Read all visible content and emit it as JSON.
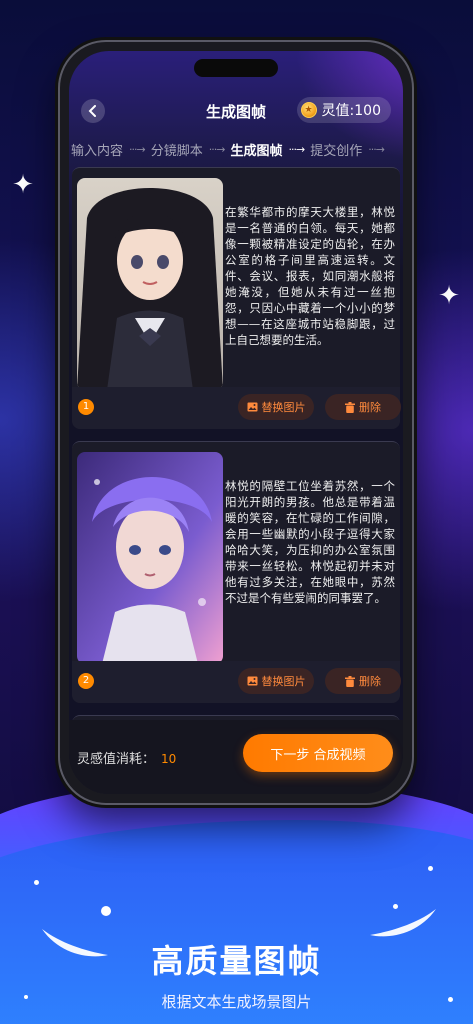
{
  "header": {
    "title": "生成图帧",
    "balance_label": "灵值:100"
  },
  "steps": [
    {
      "label": "输入内容",
      "active": false
    },
    {
      "label": "分镜脚本",
      "active": false
    },
    {
      "label": "生成图帧",
      "active": true
    },
    {
      "label": "提交创作",
      "active": false
    }
  ],
  "cards": [
    {
      "index": "1",
      "text": "在繁华都市的摩天大楼里，林悦是一名普通的白领。每天，她都像一颗被精准设定的齿轮，在办公室的格子间里高速运转。文件、会议、报表，如同潮水般将她淹没，但她从未有过一丝抱怨，只因心中藏着一个小小的梦想——在这座城市站稳脚跟，过上自己想要的生活。",
      "replace_label": "替换图片",
      "delete_label": "删除"
    },
    {
      "index": "2",
      "text": "林悦的隔壁工位坐着苏然，一个阳光开朗的男孩。他总是带着温暖的笑容，在忙碌的工作间隙，会用一些幽默的小段子逗得大家哈哈大笑，为压抑的办公室氛围带来一丝轻松。林悦起初并未对他有过多关注，在她眼中，苏然不过是个有些爱闹的同事罢了。",
      "replace_label": "替换图片",
      "delete_label": "删除"
    }
  ],
  "footer": {
    "cost_label": "灵感值消耗：",
    "cost_value": "10",
    "next_label": "下一步 合成视频"
  },
  "caption": {
    "title": "高质量图帧",
    "subtitle": "根据文本生成场景图片"
  },
  "colors": {
    "accent": "#ff8a00",
    "background": "#121226"
  }
}
